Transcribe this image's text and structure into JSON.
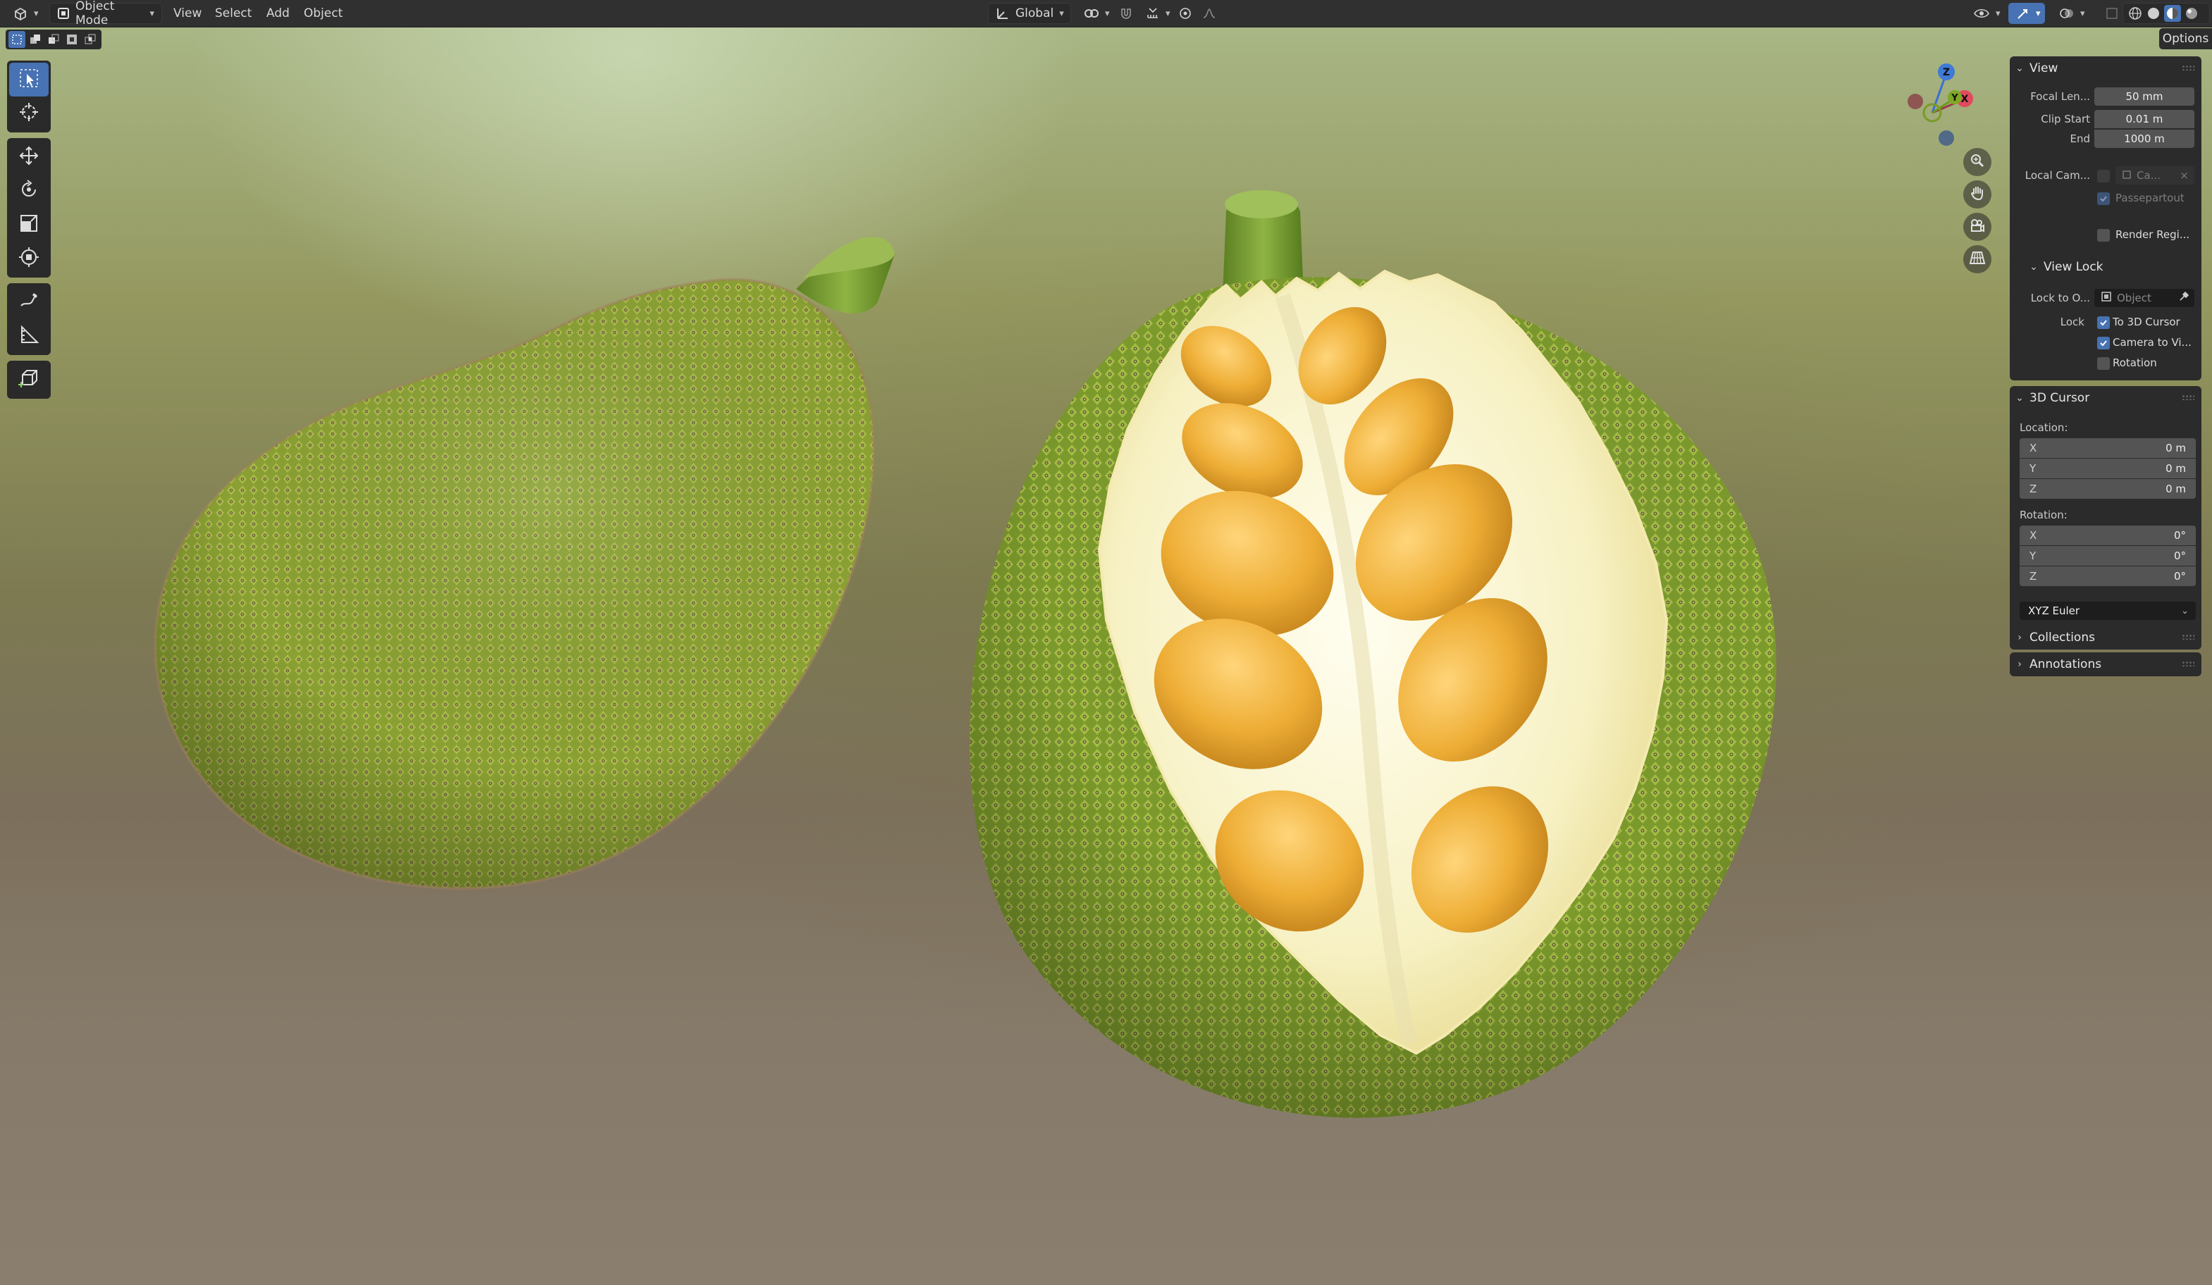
{
  "header": {
    "editor_icon": "editor-type-3d-viewport-icon",
    "mode": "Object Mode",
    "menus": [
      "View",
      "Select",
      "Add",
      "Object"
    ],
    "orientation": "Global"
  },
  "toolbar": {
    "tools": [
      "select-box-icon",
      "cursor-icon",
      "move-icon",
      "rotate-icon",
      "scale-icon",
      "transform-icon",
      "annotate-icon",
      "measure-icon",
      "add-cube-icon"
    ]
  },
  "gizmo": {
    "z": "Z",
    "y": "Y",
    "x": "X"
  },
  "options_label": "Options",
  "sidebar": {
    "view": {
      "title": "View",
      "focal_length_label": "Focal Len...",
      "focal_length": "50 mm",
      "clip_start_label": "Clip Start",
      "clip_start": "0.01 m",
      "end_label": "End",
      "end": "1000 m",
      "local_camera_label": "Local Cam...",
      "local_camera_value": "Ca...",
      "passepartout_label": "Passepartout",
      "render_region_label": "Render Regi...",
      "view_lock": {
        "title": "View Lock",
        "lock_to_object_label": "Lock to O...",
        "lock_to_object_placeholder": "Object",
        "lock_label": "Lock",
        "to_3d_cursor": "To 3D Cursor",
        "camera_to_view": "Camera to Vi...",
        "rotation": "Rotation"
      }
    },
    "cursor": {
      "title": "3D Cursor",
      "location_label": "Location:",
      "location": [
        {
          "axis": "X",
          "value": "0 m"
        },
        {
          "axis": "Y",
          "value": "0 m"
        },
        {
          "axis": "Z",
          "value": "0 m"
        }
      ],
      "rotation_label": "Rotation:",
      "rotation": [
        {
          "axis": "X",
          "value": "0°"
        },
        {
          "axis": "Y",
          "value": "0°"
        },
        {
          "axis": "Z",
          "value": "0°"
        }
      ],
      "rotation_mode": "XYZ Euler"
    },
    "collections": {
      "title": "Collections"
    },
    "annotations": {
      "title": "Annotations"
    }
  }
}
